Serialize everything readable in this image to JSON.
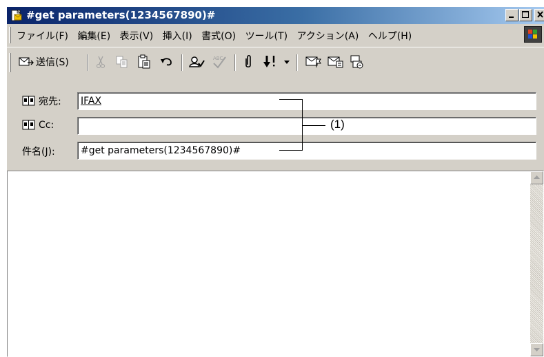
{
  "window": {
    "title": "#get parameters(1234567890)#"
  },
  "menubar": {
    "items": [
      "ファイル(F)",
      "編集(E)",
      "表示(V)",
      "挿入(I)",
      "書式(O)",
      "ツール(T)",
      "アクション(A)",
      "ヘルプ(H)"
    ]
  },
  "toolbar": {
    "send_label": "送信(S)",
    "icons": [
      "send-icon",
      "cut-icon",
      "copy-icon",
      "paste-icon",
      "undo-icon",
      "check-names-icon",
      "spell-check-icon",
      "attach-icon",
      "importance-icon",
      "dropdown-icon",
      "flag-icon",
      "options-icon",
      "encrypt-icon"
    ]
  },
  "header": {
    "to_label": "宛先:",
    "to_value": "IFAX",
    "cc_label": "Cc:",
    "cc_value": "",
    "subject_label": "件名(J):",
    "subject_value": "#get parameters(1234567890)#"
  },
  "callout": {
    "label": "(1)"
  },
  "colors": {
    "titlebar_start": "#0a246a",
    "titlebar_end": "#a6caf0",
    "chrome": "#d4d0c8"
  }
}
